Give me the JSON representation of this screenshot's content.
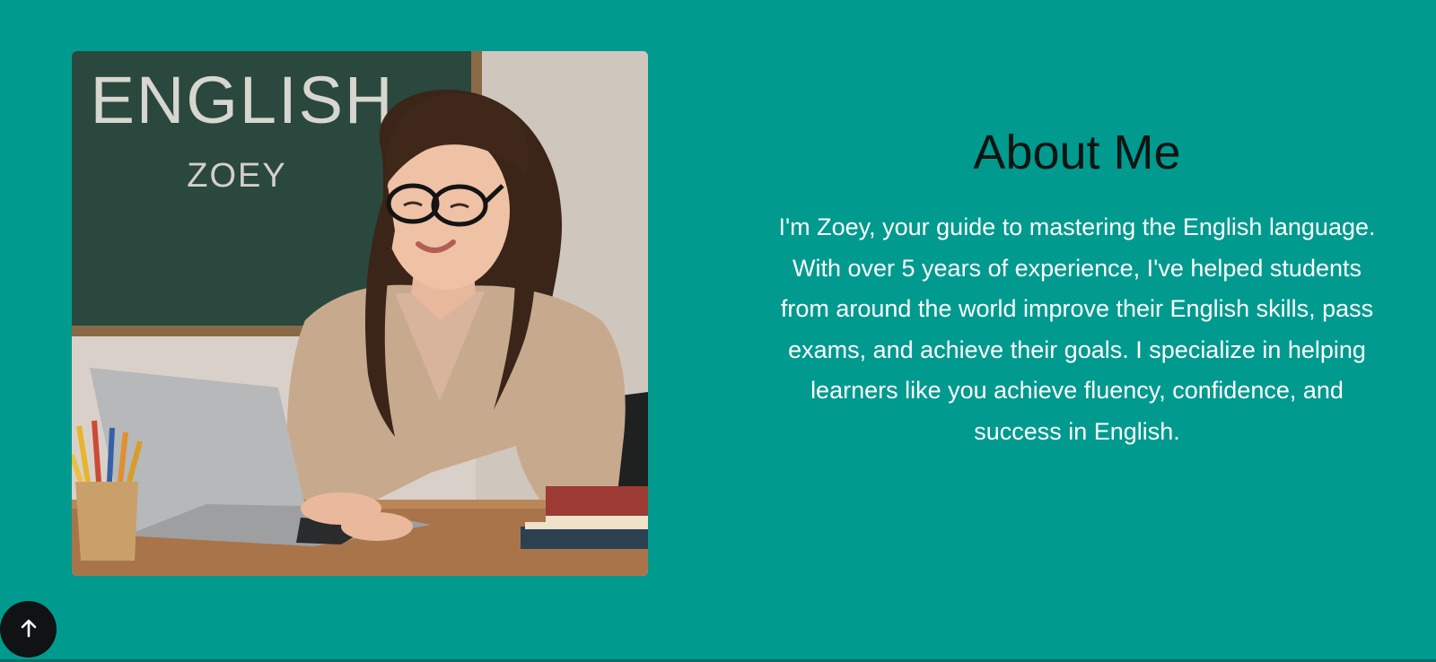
{
  "about": {
    "title": "About Me",
    "body": "I'm Zoey, your guide to mastering the English language. With over 5 years of experience, I've helped students from around the world improve their English skills, pass exams, and achieve their goals. I specialize in helping learners like you achieve fluency, confidence, and success in English."
  },
  "photo": {
    "board_heading": "ENGLISH",
    "board_name": "ZOEY"
  },
  "back_to_top": {
    "icon": "arrow-up-icon"
  },
  "colors": {
    "background": "#009a8f",
    "title": "#0f1413",
    "body_text": "#ffffff",
    "back_to_top_bg": "#101213"
  }
}
